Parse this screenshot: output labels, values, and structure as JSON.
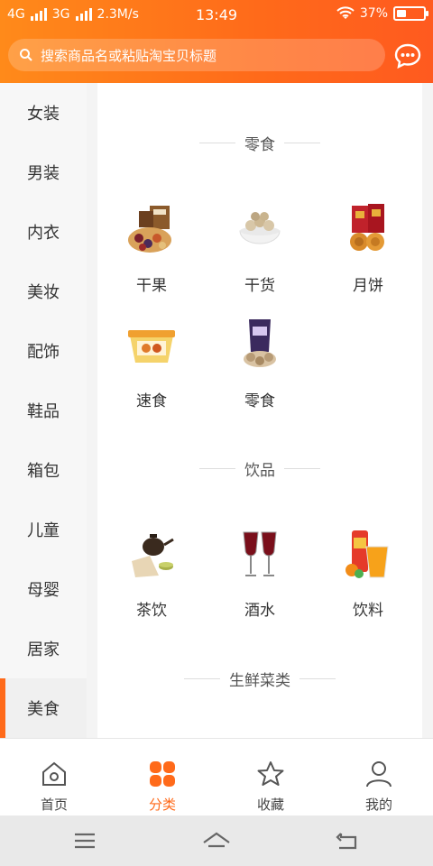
{
  "status": {
    "net1": "4G",
    "net2": "3G",
    "speed": "2.3M/s",
    "time": "13:49",
    "battery_percent": "37%",
    "battery_level": 0.37
  },
  "search": {
    "placeholder": "搜索商品名或粘贴淘宝贝标题",
    "search_icon": "search-icon",
    "message_icon": "chat-bubble-icon"
  },
  "sidebar": {
    "items": [
      {
        "label": "女装"
      },
      {
        "label": "男装"
      },
      {
        "label": "内衣"
      },
      {
        "label": "美妆"
      },
      {
        "label": "配饰"
      },
      {
        "label": "鞋品"
      },
      {
        "label": "箱包"
      },
      {
        "label": "儿童"
      },
      {
        "label": "母婴"
      },
      {
        "label": "居家"
      },
      {
        "label": "美食"
      }
    ],
    "active_index": 10
  },
  "main": {
    "sections": [
      {
        "title": "零食",
        "items": [
          {
            "label": "干果",
            "icon": "dried-fruit-icon"
          },
          {
            "label": "干货",
            "icon": "nuts-bowl-icon"
          },
          {
            "label": "月饼",
            "icon": "mooncake-icon"
          },
          {
            "label": "速食",
            "icon": "instant-food-icon"
          },
          {
            "label": "零食",
            "icon": "snack-bag-icon"
          }
        ]
      },
      {
        "title": "饮品",
        "items": [
          {
            "label": "茶饮",
            "icon": "tea-set-icon"
          },
          {
            "label": "酒水",
            "icon": "wine-glasses-icon"
          },
          {
            "label": "饮料",
            "icon": "juice-drink-icon"
          }
        ]
      },
      {
        "title": "生鲜菜类",
        "items": []
      }
    ]
  },
  "tabbar": {
    "tabs": [
      {
        "label": "首页",
        "icon": "home-icon"
      },
      {
        "label": "分类",
        "icon": "category-icon"
      },
      {
        "label": "收藏",
        "icon": "star-icon"
      },
      {
        "label": "我的",
        "icon": "user-icon"
      }
    ],
    "active_index": 1
  },
  "colors": {
    "accent": "#ff6a1a",
    "header_start": "#ff8a1a",
    "header_end": "#ff5a1f"
  },
  "sysnav": {
    "menu_icon": "menu-icon",
    "home_icon": "home-outline-icon",
    "back_icon": "back-icon"
  }
}
